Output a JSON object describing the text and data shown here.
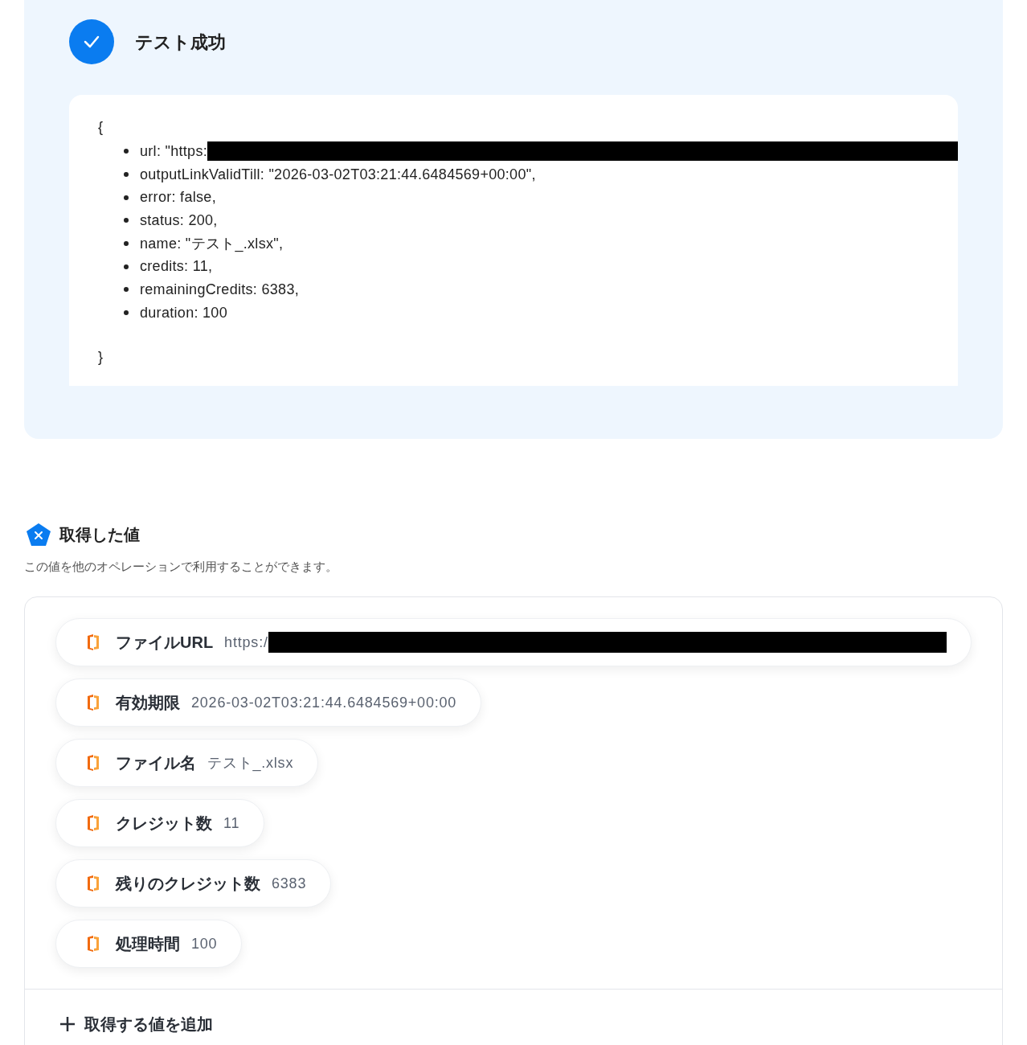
{
  "test_result": {
    "title": "テスト成功",
    "success": true,
    "open_brace": "{",
    "close_brace": "}",
    "lines": [
      {
        "text": "url: \"https:",
        "redacted": true
      },
      {
        "text": "outputLinkValidTill: \"2026-03-02T03:21:44.6484569+00:00\",",
        "redacted": false
      },
      {
        "text": "error: false,",
        "redacted": false
      },
      {
        "text": "status: 200,",
        "redacted": false
      },
      {
        "text": "name: \"テスト_.xlsx\",",
        "redacted": false
      },
      {
        "text": "credits: 11,",
        "redacted": false
      },
      {
        "text": "remainingCredits: 6383,",
        "redacted": false
      },
      {
        "text": "duration: 100",
        "redacted": false
      }
    ]
  },
  "values_section": {
    "title": "取得した値",
    "description": "この値を他のオペレーションで利用することができます。",
    "items": [
      {
        "label": "ファイルURL",
        "value": "https:/",
        "redacted": true
      },
      {
        "label": "有効期限",
        "value": "2026-03-02T03:21:44.6484569+00:00",
        "redacted": false
      },
      {
        "label": "ファイル名",
        "value": "テスト_.xlsx",
        "redacted": false
      },
      {
        "label": "クレジット数",
        "value": "11",
        "redacted": false
      },
      {
        "label": "残りのクレジット数",
        "value": "6383",
        "redacted": false
      },
      {
        "label": "処理時間",
        "value": "100",
        "redacted": false
      }
    ],
    "add_button": "取得する値を追加"
  }
}
